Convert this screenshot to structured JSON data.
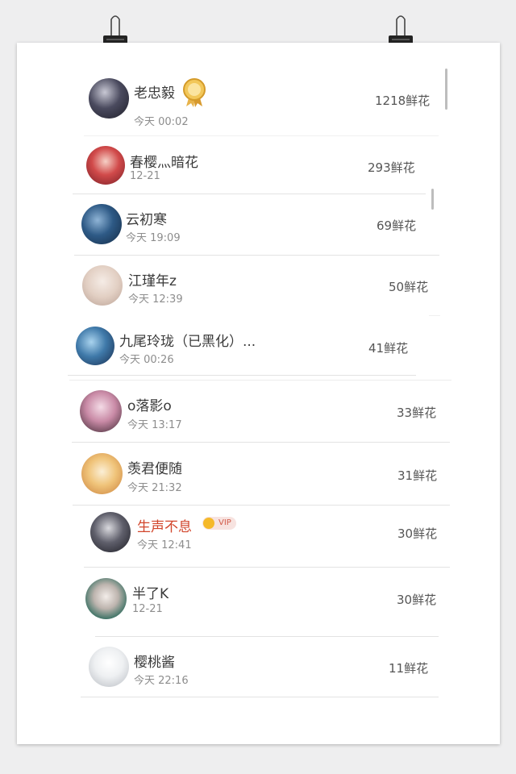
{
  "ranking": [
    {
      "name": "老忠毅",
      "time": "今天 00:02",
      "flowers": "1218鲜花",
      "badge": "medal-icon"
    },
    {
      "name": "春樱灬暗花",
      "time": "12-21",
      "flowers": "293鲜花"
    },
    {
      "name": "云初寒",
      "time": "今天 19:09",
      "flowers": "69鲜花"
    },
    {
      "name": "江瑾年z",
      "time": "今天 12:39",
      "flowers": "50鲜花"
    },
    {
      "name": "九尾玲珑（已黑化）...",
      "time": "今天 00:26",
      "flowers": "41鲜花"
    },
    {
      "name": "o落影o",
      "time": "今天 13:17",
      "flowers": "33鲜花"
    },
    {
      "name": "羡君便随",
      "time": "今天 21:32",
      "flowers": "31鲜花"
    },
    {
      "name": "生声不息",
      "time": "今天 12:41",
      "flowers": "30鲜花",
      "name_color": "#d2462c",
      "badge_text": "VIP"
    },
    {
      "name": "半了K",
      "time": "12-21",
      "flowers": "30鲜花"
    },
    {
      "name": "樱桃酱",
      "time": "今天 22:16",
      "flowers": "11鲜花"
    }
  ],
  "colors": {
    "vip_name": "#d2462c",
    "background": "#eeeeef",
    "paper": "#ffffff"
  }
}
